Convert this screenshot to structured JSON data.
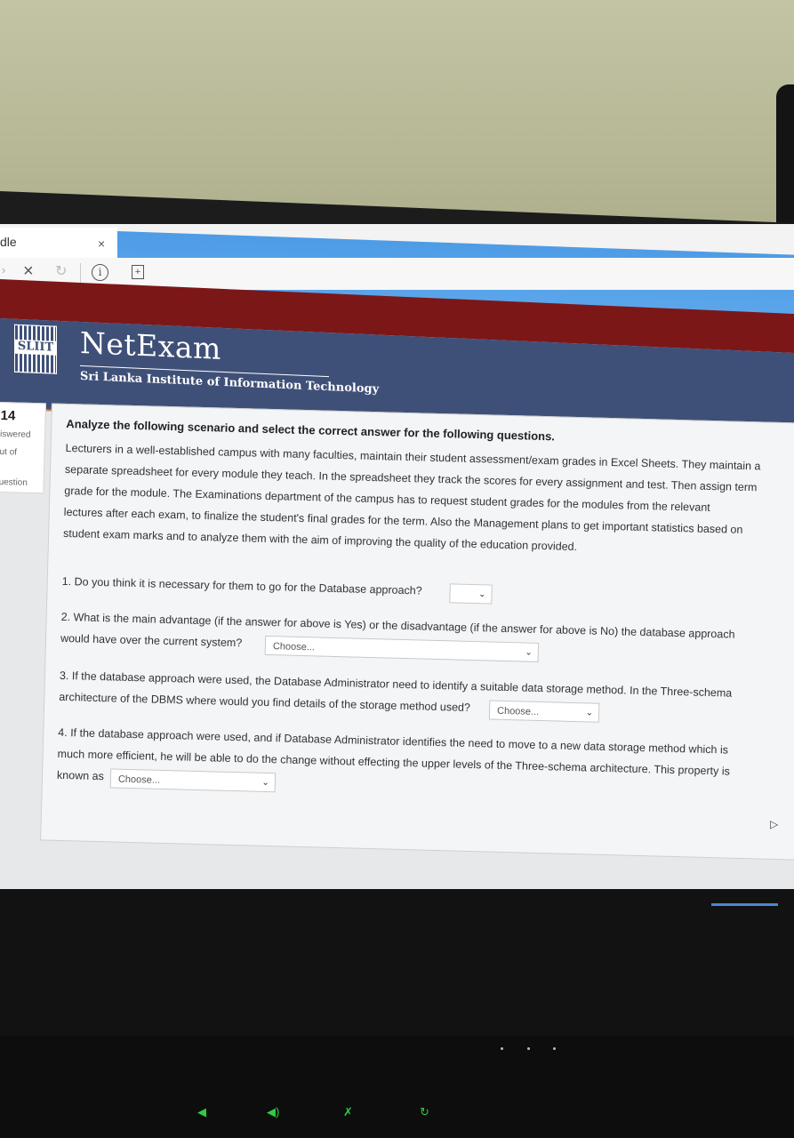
{
  "browser": {
    "tab_label": "dle",
    "tab_close": "×",
    "nav_back": "›",
    "nav_stop": "×",
    "nav_reload": "↻",
    "nav_info": "i",
    "nav_newtab": "+"
  },
  "header": {
    "logo_text": "SLIIT",
    "brand": "NetExam",
    "subtitle": "Sri Lanka Institute of Information Technology"
  },
  "sidebar": {
    "question_number": "14",
    "status": "iswered",
    "marks": "ut of",
    "flag": "uestion"
  },
  "question": {
    "heading": "Analyze the following scenario and select the correct answer for the following questions.",
    "scenario": [
      "Lecturers in a well-established campus with many faculties, maintain their student assessment/exam grades in Excel Sheets. They maintain a",
      "separate spreadsheet for every module they teach. In the spreadsheet they track the scores for every assignment and test. Then assign term",
      "grade for the module. The Examinations department of the campus has to request student grades for the modules from the relevant",
      "lectures after each exam, to finalize the student's final grades for the term. Also the Management plans to get important statistics based on",
      "student exam marks and to analyze them with the aim of improving the quality of the education provided."
    ],
    "items": [
      {
        "lines": [
          "1. Do you think it is necessary for them to go for the Database approach?"
        ],
        "select_value": ""
      },
      {
        "lines": [
          "2. What is the main advantage (if the answer for above is Yes) or the disadvantage (if the answer for above is No) the database approach",
          "would have over the current system?"
        ],
        "select_value": "Choose..."
      },
      {
        "lines": [
          "3. If the database approach were used, the Database Administrator need to identify a suitable data storage method. In the Three-schema",
          "architecture of the DBMS where would you find details of the storage method used?"
        ],
        "select_value": "Choose..."
      },
      {
        "lines": [
          "4. If the database approach were used, and if Database Administrator identifies the need to move to a new data storage method which is",
          "much more efficient, he will be able to do the change without effecting the upper levels of the Three-schema architecture. This property is",
          "known as"
        ],
        "select_value": "Choose..."
      }
    ]
  },
  "icons": {
    "chevron": "chevron-down-icon",
    "cursor": "mouse-cursor-icon"
  }
}
